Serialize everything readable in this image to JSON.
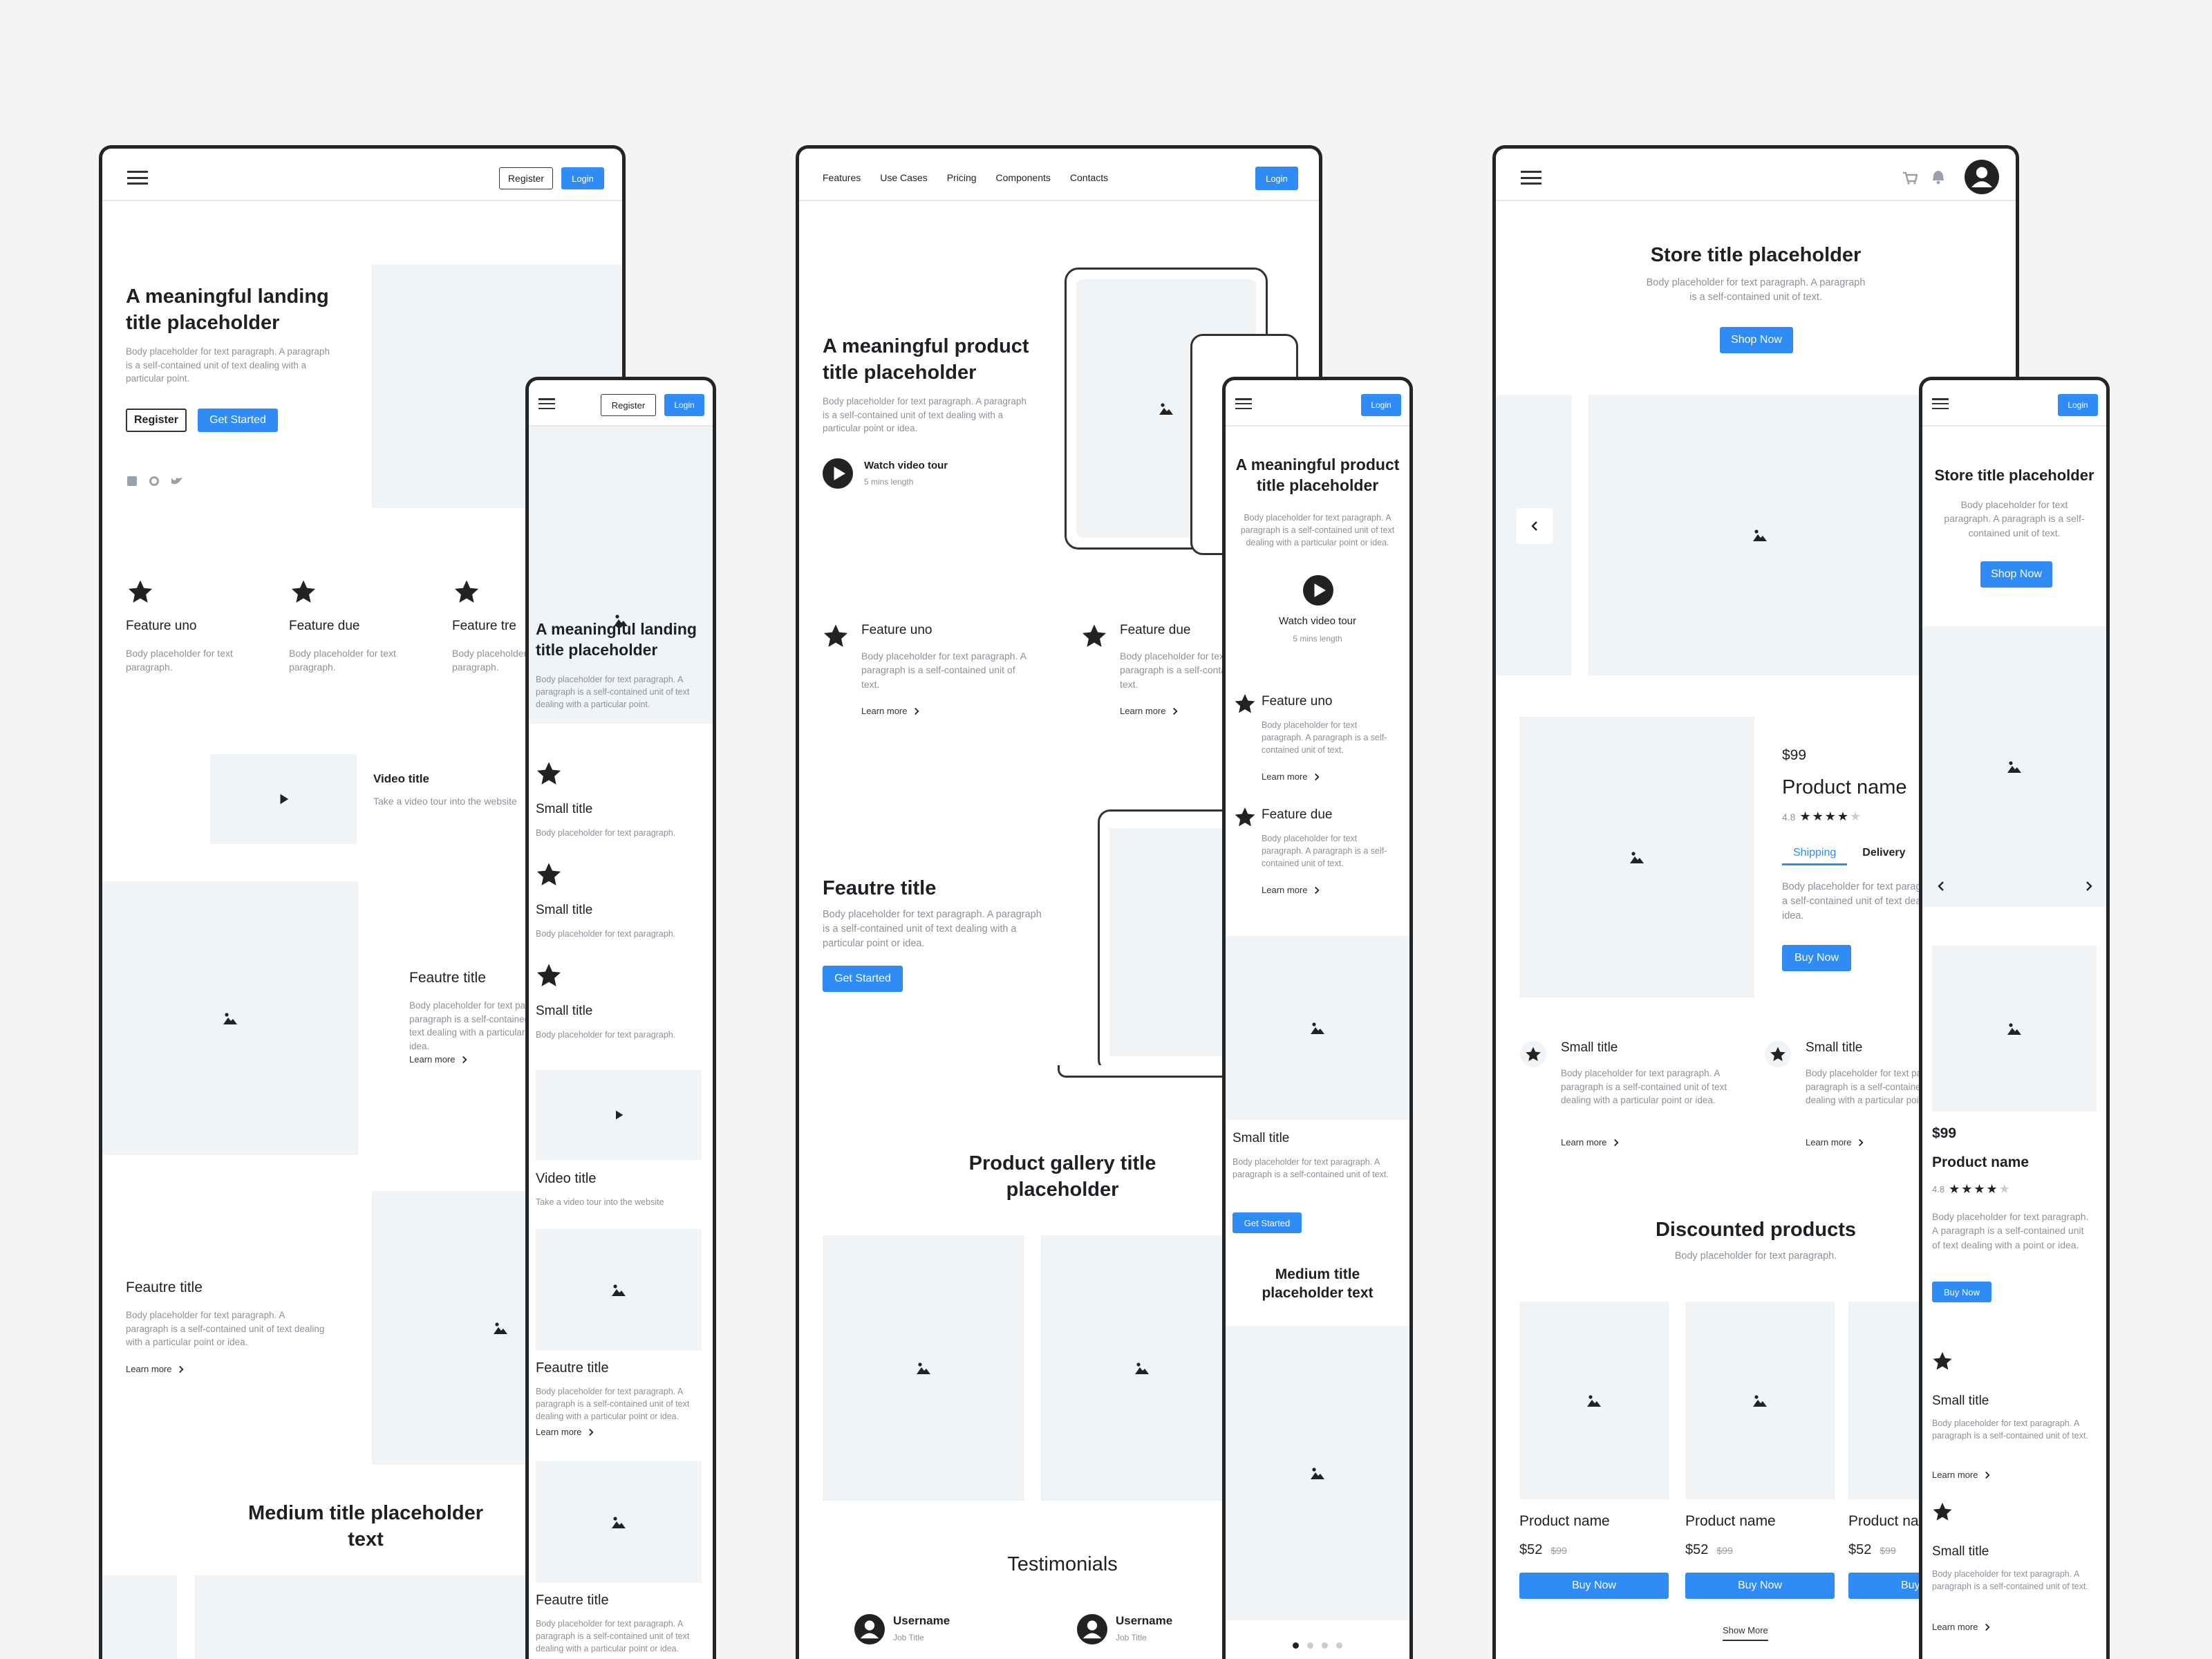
{
  "colors": {
    "accent": "#2f8cf5",
    "frame": "#232628",
    "placeholder": "#f1f4f7",
    "body_text": "#8b929b",
    "background": "#f4f4f5"
  },
  "common": {
    "register": "Register",
    "login": "Login",
    "get_started": "Get Started",
    "learn_more": "Learn more",
    "shop_now": "Shop Now",
    "buy_now": "Buy Now",
    "show_more": "Show More",
    "watch_video": "Watch video tour",
    "mins": "5 mins length",
    "body_short": "Body placeholder for text paragraph.",
    "body_para": "Body placeholder for text paragraph. A paragraph is a self-contained unit of text dealing with a particular point or idea."
  },
  "landing": {
    "title": "A meaningful landing title placeholder",
    "body": "Body placeholder for text paragraph. A paragraph is a self-contained unit of text dealing with a particular point.",
    "features": [
      {
        "title": "Feature uno"
      },
      {
        "title": "Feature due"
      },
      {
        "title": "Feature tre"
      }
    ],
    "video_title": "Video title",
    "video_body": "Take a video tour into the website",
    "feature_title": "Feautre title",
    "medium_title": "Medium title placeholder text"
  },
  "landing_mobile": {
    "small_title": "Small title",
    "video_title": "Video title",
    "video_body": "Take a video tour into the website",
    "feature_title": "Feautre title"
  },
  "product": {
    "nav": [
      "Features",
      "Use Cases",
      "Pricing",
      "Components",
      "Contacts"
    ],
    "title": "A meaningful product title placeholder",
    "body": "Body placeholder for text paragraph. A paragraph is a self-contained unit of text dealing with a particular point or idea.",
    "features": [
      {
        "title": "Feature uno",
        "body": "Body placeholder for text paragraph. A paragraph is a self-contained unit of text."
      },
      {
        "title": "Feature due",
        "body": "Body placeholder for text paragraph. A paragraph is a self-contained unit of text."
      }
    ],
    "feature_title": "Feautre title",
    "gallery_title": "Product gallery title placeholder",
    "testimonials": "Testimonials",
    "username": "Username",
    "job_title": "Job Title"
  },
  "product_mobile": {
    "small_title": "Small title",
    "small_body": "Body placeholder for text paragraph. A paragraph is a self-contained unit of text.",
    "medium_title": "Medium title placeholder text",
    "page_dots": 4
  },
  "store": {
    "title": "Store title placeholder",
    "body": "Body placeholder for text paragraph. A paragraph is a self-contained unit of text.",
    "price": "$99",
    "product_name": "Product name",
    "rating": "4.8",
    "stars_filled": 4,
    "stars_total": 5,
    "tabs": [
      "Shipping",
      "Delivery"
    ],
    "tab_body": "Body placeholder for text paragraph. A paragraph is a self-contained unit of text dealing with a point or idea.",
    "small_title": "Small title",
    "discounted_title": "Discounted products",
    "products": [
      {
        "name": "Product name",
        "price": "$52",
        "old": "$99"
      },
      {
        "name": "Product name",
        "price": "$52",
        "old": "$99"
      },
      {
        "name": "Product na",
        "price": "$52",
        "old": "$99"
      }
    ]
  },
  "store_mobile": {
    "title": "Store title placeholder",
    "body": "Body placeholder for text paragraph. A paragraph is a self-contained unit of text.",
    "small_title": "Small title",
    "product_body": "Body placeholder for text paragraph. A paragraph is a self-contained unit of text dealing with a point or idea."
  }
}
